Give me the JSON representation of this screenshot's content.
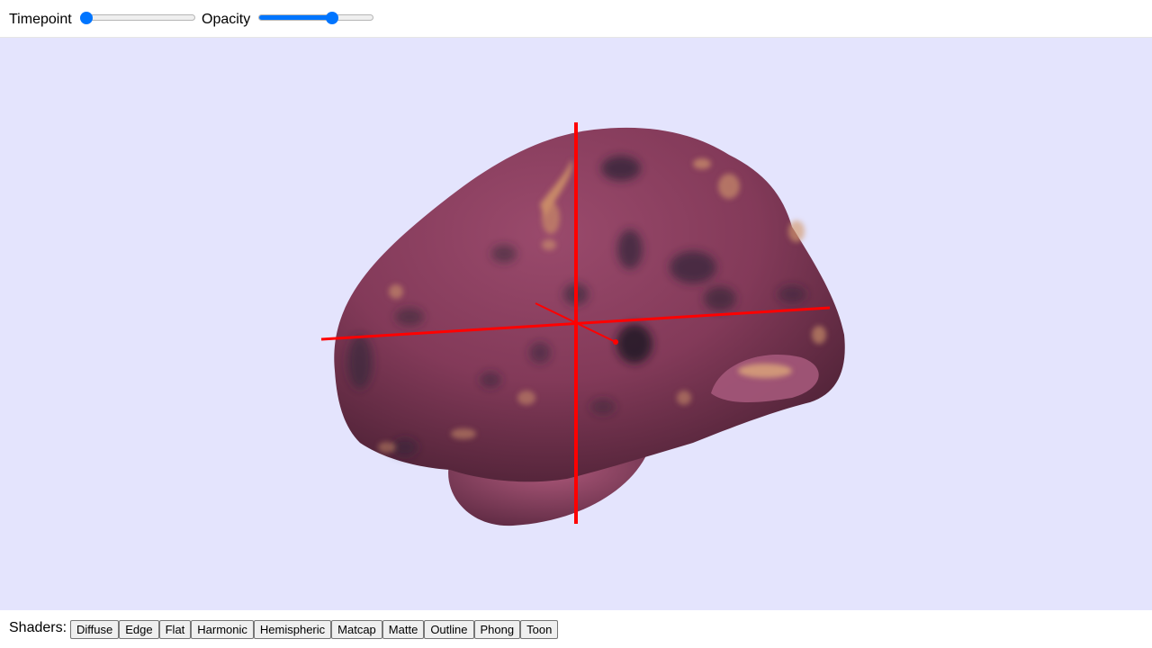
{
  "toolbar": {
    "timepoint_label": "Timepoint",
    "timepoint_value": 0.0,
    "opacity_label": "Opacity",
    "opacity_value": 0.66
  },
  "viewer": {
    "background_color": "#e4e4fd",
    "mesh_color": "#8a3b5a",
    "crosshair_color": "#ff0000"
  },
  "shaders": {
    "label": "Shaders:",
    "buttons": [
      "Diffuse",
      "Edge",
      "Flat",
      "Harmonic",
      "Hemispheric",
      "Matcap",
      "Matte",
      "Outline",
      "Phong",
      "Toon"
    ]
  }
}
